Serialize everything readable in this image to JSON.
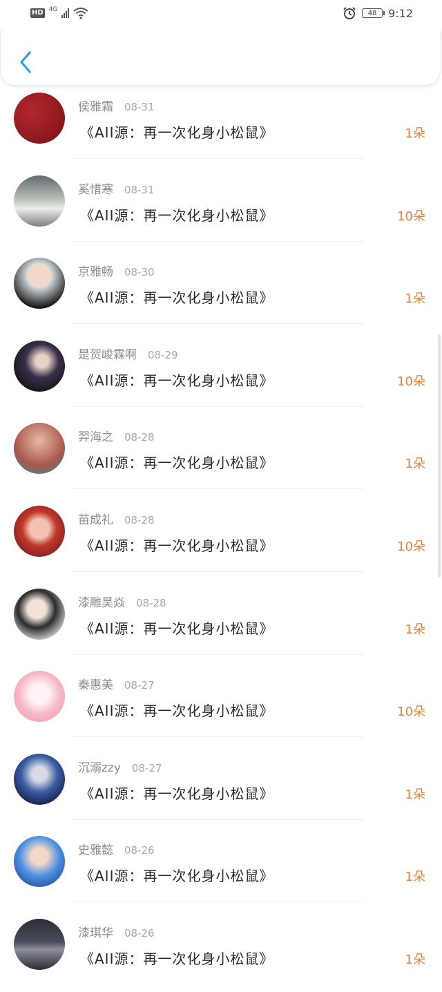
{
  "status_bar": {
    "hd": "HD",
    "network": "4G",
    "battery": "48",
    "time": "9:12"
  },
  "items": [
    {
      "name": "侯雅霜",
      "date": "08-31",
      "gift": "《AII源：再一次化身小松鼠》",
      "count": "1朵"
    },
    {
      "name": "奚惜寒",
      "date": "08-31",
      "gift": "《AII源：再一次化身小松鼠》",
      "count": "10朵"
    },
    {
      "name": "京雅畅",
      "date": "08-30",
      "gift": "《AII源：再一次化身小松鼠》",
      "count": "1朵"
    },
    {
      "name": "是贺峻霖啊",
      "date": "08-29",
      "gift": "《AII源：再一次化身小松鼠》",
      "count": "10朵"
    },
    {
      "name": "羿海之",
      "date": "08-28",
      "gift": "《AII源：再一次化身小松鼠》",
      "count": "1朵"
    },
    {
      "name": "苗成礼",
      "date": "08-28",
      "gift": "《AII源：再一次化身小松鼠》",
      "count": "10朵"
    },
    {
      "name": "漆雕昊焱",
      "date": "08-28",
      "gift": "《AII源：再一次化身小松鼠》",
      "count": "1朵"
    },
    {
      "name": "秦惠美",
      "date": "08-27",
      "gift": "《AII源：再一次化身小松鼠》",
      "count": "10朵"
    },
    {
      "name": "沉溺zzy",
      "date": "08-27",
      "gift": "《AII源：再一次化身小松鼠》",
      "count": "1朵"
    },
    {
      "name": "史雅懿",
      "date": "08-26",
      "gift": "《AII源：再一次化身小松鼠》",
      "count": "1朵"
    },
    {
      "name": "漆琪华",
      "date": "08-26",
      "gift": "《AII源：再一次化身小松鼠》",
      "count": "1朵"
    }
  ],
  "colors": {
    "accent": "#2d9ee6",
    "count": "#e8823a",
    "date": "#a8a8a8",
    "name": "#8c8c8c",
    "avatars": [
      "#8e1a1f",
      "#8a8f86",
      "#d9dde0",
      "#1c1a2a",
      "#c98d79",
      "#b52c2f",
      "#e5e2df",
      "#f3c6d3",
      "#21315f",
      "#3a7fd1",
      "#3d3e4a"
    ]
  }
}
